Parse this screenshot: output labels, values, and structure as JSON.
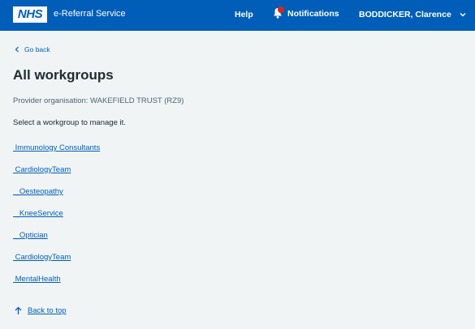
{
  "header": {
    "logo_text": "NHS",
    "service_name": "e-Referral Service",
    "help_label": "Help",
    "notifications_label": "Notifications",
    "user_name": "BODDICKER, Clarence",
    "brand_color": "#005eb8",
    "badge_color": "#d5281b"
  },
  "main": {
    "back_link_label": "Go back",
    "title": "All workgroups",
    "provider_org": "Provider organisation: WAKEFIELD TRUST (RZ9)",
    "instruction": "Select a workgroup to manage it.",
    "workgroups": [
      {
        "label": " Immunology Consultants"
      },
      {
        "label": " CardiologyTeam"
      },
      {
        "label": " _Oesteopathy"
      },
      {
        "label": " _KneeService"
      },
      {
        "label": " _Optician"
      },
      {
        "label": " CardiologyTeam"
      },
      {
        "label": " MentalHealth"
      }
    ],
    "back_to_top_label": "Back to top"
  },
  "icons": {
    "bell": "bell-icon",
    "chevron_down": "chevron-down-icon",
    "chevron_left": "chevron-left-icon",
    "arrow_up": "arrow-up-icon"
  }
}
